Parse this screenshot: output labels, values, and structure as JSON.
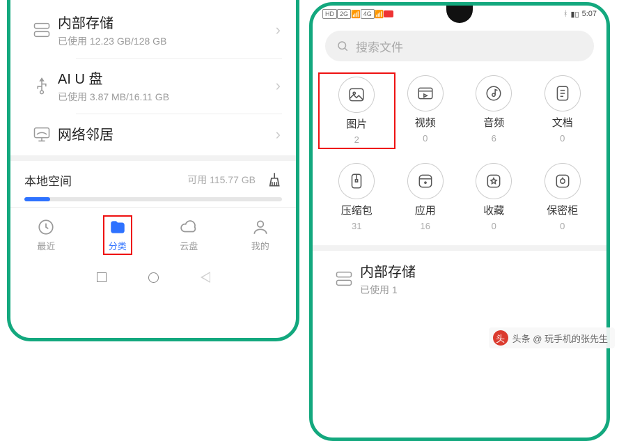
{
  "left": {
    "storage_rows": [
      {
        "title": "内部存储",
        "sub": "已使用 12.23 GB/128 GB",
        "icon": "internal"
      },
      {
        "title": "AI U 盘",
        "sub": "已使用 3.87 MB/16.11 GB",
        "icon": "usb"
      },
      {
        "title": "网络邻居",
        "sub": "",
        "icon": "network"
      }
    ],
    "local_space": {
      "title": "本地空间",
      "available": "可用 115.77 GB"
    },
    "tabs": [
      {
        "label": "最近",
        "key": "recent"
      },
      {
        "label": "分类",
        "key": "category"
      },
      {
        "label": "云盘",
        "key": "cloud"
      },
      {
        "label": "我的",
        "key": "mine"
      }
    ],
    "active_tab": 1,
    "highlight_tab": 1
  },
  "right": {
    "status_time": "5:07",
    "search_placeholder": "搜索文件",
    "categories": [
      {
        "label": "图片",
        "count": "2",
        "icon": "image",
        "highlight": true
      },
      {
        "label": "视频",
        "count": "0",
        "icon": "video"
      },
      {
        "label": "音频",
        "count": "6",
        "icon": "audio"
      },
      {
        "label": "文档",
        "count": "0",
        "icon": "doc"
      },
      {
        "label": "压缩包",
        "count": "31",
        "icon": "zip"
      },
      {
        "label": "应用",
        "count": "16",
        "icon": "app"
      },
      {
        "label": "收藏",
        "count": "0",
        "icon": "fav"
      },
      {
        "label": "保密柜",
        "count": "0",
        "icon": "safe"
      }
    ],
    "storage_row": {
      "title": "内部存储",
      "sub_prefix": "已使用 1"
    }
  },
  "watermark": {
    "icon": "头",
    "text": "头条 @ 玩手机的张先生"
  }
}
